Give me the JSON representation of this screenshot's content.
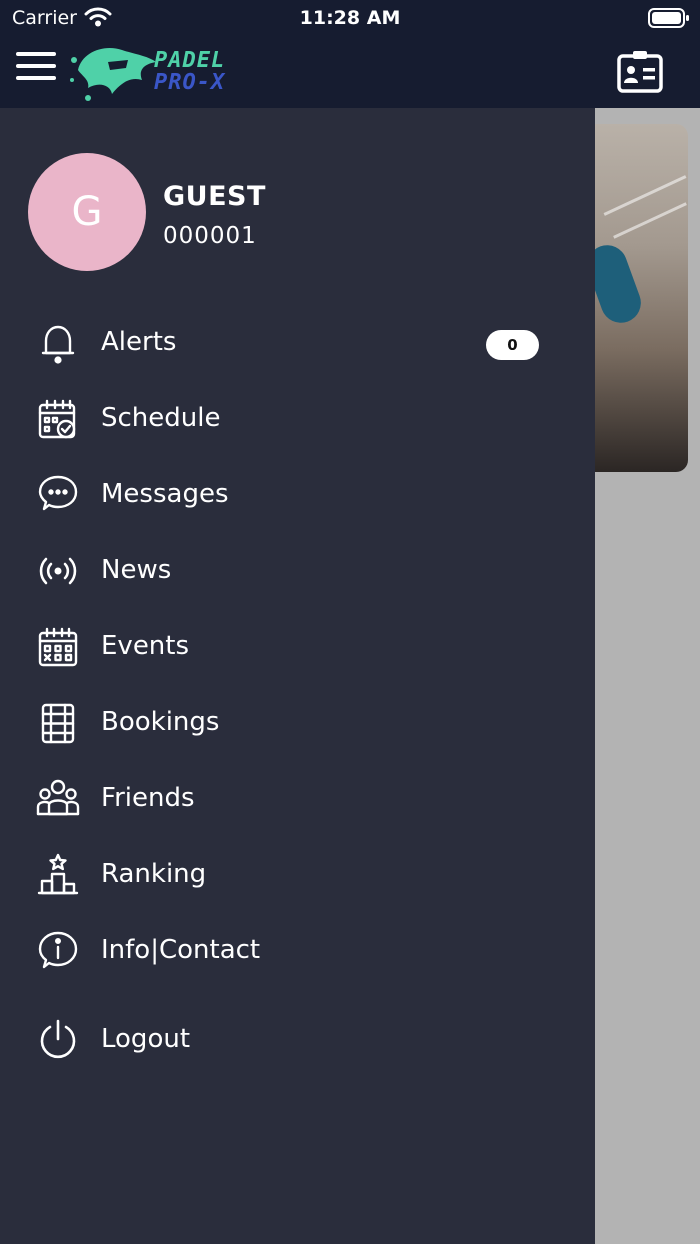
{
  "status_bar": {
    "carrier": "Carrier",
    "time": "11:28 AM"
  },
  "header": {
    "logo_line1": "PADEL",
    "logo_line2": "PRO-X",
    "menu_icon": "hamburger-icon",
    "contact_icon": "id-card-icon"
  },
  "colors": {
    "header_bg": "#161c30",
    "drawer_bg": "#2a2d3c",
    "avatar_bg": "#eab5c9",
    "logo_green": "#4fd1a8",
    "logo_blue": "#3a56c8"
  },
  "profile": {
    "initial": "G",
    "name": "GUEST",
    "id": "000001"
  },
  "menu": [
    {
      "label": "Alerts",
      "icon": "bell-icon",
      "badge": "0"
    },
    {
      "label": "Schedule",
      "icon": "calendar-check-icon"
    },
    {
      "label": "Messages",
      "icon": "chat-bubble-icon"
    },
    {
      "label": "News",
      "icon": "broadcast-icon"
    },
    {
      "label": "Events",
      "icon": "calendar-grid-icon"
    },
    {
      "label": "Bookings",
      "icon": "court-icon"
    },
    {
      "label": "Friends",
      "icon": "group-icon"
    },
    {
      "label": "Ranking",
      "icon": "podium-icon"
    },
    {
      "label": "Info|Contact",
      "icon": "info-bubble-icon"
    },
    {
      "label": "Logout",
      "icon": "power-icon"
    }
  ]
}
